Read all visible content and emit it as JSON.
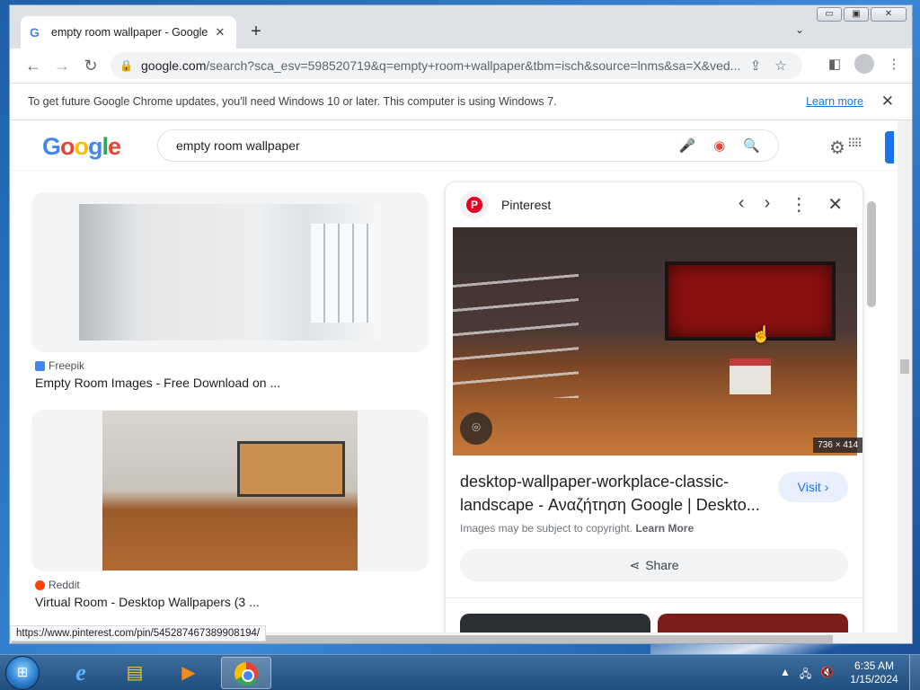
{
  "browser": {
    "tab_title": "empty room wallpaper - Google",
    "tab_favicon": "G",
    "tab_close": "✕",
    "new_tab": "+",
    "tab_search": "⌄",
    "window_controls": {
      "minimize": "▭",
      "restore": "▣",
      "close": "✕"
    },
    "toolbar": {
      "back": "←",
      "forward": "→",
      "reload": "↻"
    },
    "url_host": "google.com",
    "url_path": "/search?sca_esv=598520719&q=empty+room+wallpaper&tbm=isch&source=lnms&sa=X&ved...",
    "lock_icon": "🔒"
  },
  "infobar": {
    "message": "To get future Google Chrome updates, you'll need Windows 10 or later. This computer is using Windows 7.",
    "link": "Learn more",
    "close": "✕"
  },
  "search": {
    "query": "empty room wallpaper",
    "icons": {
      "mic": "🎤",
      "lens": "◉",
      "search": "🔍"
    }
  },
  "results": [
    {
      "source": "Freepik",
      "title": "Empty Room Images - Free Download on ..."
    },
    {
      "source": "Reddit",
      "title": "Virtual Room - Desktop Wallpapers (3 ..."
    }
  ],
  "panel": {
    "source_name": "Pinterest",
    "source_glyph": "P",
    "controls": {
      "prev": "‹",
      "next": "›",
      "more": "⋮",
      "close": "✕"
    },
    "dimensions": "736 × 414",
    "title": "desktop-wallpaper-workplace-classic-landscape - Αναζήτηση Google | Deskto...",
    "visit_label": "Visit ›",
    "copyright_text": "Images may be subject to copyright.",
    "copyright_link": "Learn More",
    "share_label": "Share"
  },
  "status_url": "https://www.pinterest.com/pin/545287467389908194/",
  "taskbar": {
    "start": "⊞",
    "ie": "e",
    "folder": "▤",
    "media": "▶",
    "tray": {
      "arrow": "▲",
      "network": "🖧",
      "volume": "🔇"
    },
    "time": "6:35 AM",
    "date": "1/15/2024"
  }
}
